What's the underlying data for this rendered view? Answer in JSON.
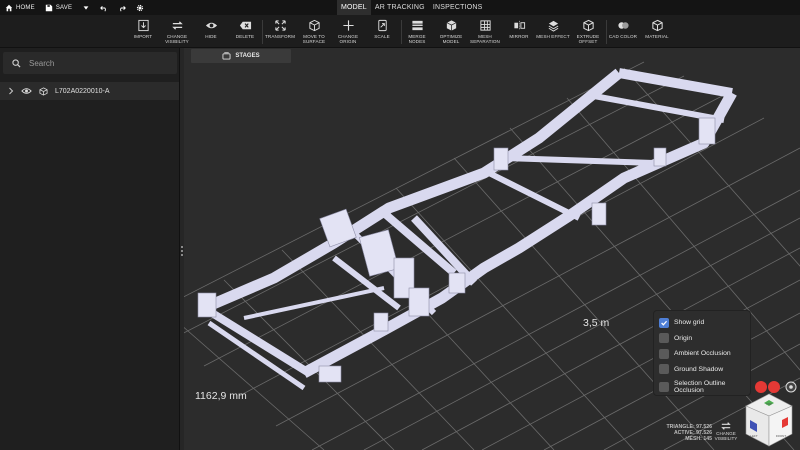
{
  "topbar": {
    "home": "HOME",
    "save": "SAVE",
    "tabs": [
      "MODEL",
      "AR TRACKING",
      "INSPECTIONS"
    ]
  },
  "toolbar": {
    "tools": [
      {
        "label": "IMPORT",
        "icon": "import-icon"
      },
      {
        "label": "CHANGE\nVISIBILITY",
        "icon": "change-visibility-icon"
      },
      {
        "label": "HIDE",
        "icon": "eye-icon"
      },
      {
        "label": "DELETE",
        "icon": "delete-icon"
      },
      {
        "label": "TRANSFORM",
        "icon": "transform-icon"
      },
      {
        "label": "MOVE TO\nSURFACE",
        "icon": "move-to-surface-icon"
      },
      {
        "label": "CHANGE\nORIGIN",
        "icon": "change-origin-icon"
      },
      {
        "label": "SCALE",
        "icon": "scale-icon"
      },
      {
        "label": "MERGE\nNODES",
        "icon": "merge-nodes-icon"
      },
      {
        "label": "OPTIMIZE\nMODEL",
        "icon": "optimize-model-icon"
      },
      {
        "label": "MESH\nSEPARATION",
        "icon": "mesh-separation-icon"
      },
      {
        "label": "MIRROR",
        "icon": "mirror-icon"
      },
      {
        "label": "MESH EFFECT",
        "icon": "mesh-effect-icon"
      },
      {
        "label": "EXTRUDE\nOFFSET",
        "icon": "extrude-offset-icon"
      },
      {
        "label": "CAD COLOR",
        "icon": "cad-color-icon"
      },
      {
        "label": "MATERIAL",
        "icon": "material-icon"
      }
    ]
  },
  "sidebar": {
    "search_placeholder": "Search",
    "tree": [
      {
        "name": "L702A0220010-A"
      }
    ]
  },
  "viewport": {
    "stages_label": "STAGES",
    "dim_length": "3,5 m",
    "dim_width": "1162,9 mm"
  },
  "options": [
    {
      "label": "Show grid",
      "checked": true
    },
    {
      "label": "Origin",
      "checked": false
    },
    {
      "label": "Ambient Occlusion",
      "checked": false
    },
    {
      "label": "Ground Shadow",
      "checked": false
    },
    {
      "label": "Selection Outline\nOcclusion",
      "checked": false
    }
  ],
  "stats": {
    "triangle": "TRIANGLE: 97.526",
    "active": "ACTIVE: 97.526",
    "mesh": "MESH: 145",
    "change_visibility": "CHANGE\nVISIBILITY"
  },
  "viewcube": {
    "faces": [
      "TOP",
      "LEFT",
      "FRONT"
    ],
    "colors": {
      "top": "#4caf50",
      "left": "#3f51b5",
      "front": "#e53935"
    }
  }
}
